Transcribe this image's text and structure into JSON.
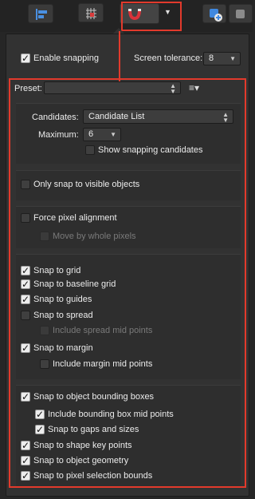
{
  "toolbar": {
    "align_icon": "align-left-icon",
    "grid_icon": "grid-icon",
    "magnet_icon": "magnet-icon",
    "dropdown_icon": "chevron-down-icon",
    "insert_icon": "insert-shape-icon"
  },
  "snapping": {
    "enable_label": "Enable snapping",
    "enabled": true,
    "tolerance_label": "Screen tolerance:",
    "tolerance_value": "8",
    "preset_label": "Preset:",
    "preset_value": "",
    "candidates_label": "Candidates:",
    "candidates_value": "Candidate List",
    "maximum_label": "Maximum:",
    "maximum_value": "6",
    "show_candidates_label": "Show snapping candidates"
  },
  "options": [
    {
      "label": "Only snap to visible objects",
      "checked": false
    },
    {
      "label": "Force pixel alignment",
      "checked": false
    },
    {
      "label": "Move by whole pixels",
      "checked": false,
      "disabled": true
    },
    {
      "label": "Snap to grid",
      "checked": true
    },
    {
      "label": "Snap to baseline grid",
      "checked": true
    },
    {
      "label": "Snap to guides",
      "checked": true
    },
    {
      "label": "Snap to spread",
      "checked": false
    },
    {
      "label": "Include spread mid points",
      "checked": false,
      "disabled": true
    },
    {
      "label": "Snap to margin",
      "checked": true
    },
    {
      "label": "Include margin mid points",
      "checked": false
    },
    {
      "label": "Snap to object bounding boxes",
      "checked": true
    },
    {
      "label": "Include bounding box mid points",
      "checked": true
    },
    {
      "label": "Snap to gaps and sizes",
      "checked": true
    },
    {
      "label": "Snap to shape key points",
      "checked": true
    },
    {
      "label": "Snap to object geometry",
      "checked": true
    },
    {
      "label": "Snap to pixel selection bounds",
      "checked": true
    }
  ],
  "colors": {
    "highlight": "#e23a2c",
    "accent": "#2f7de1"
  }
}
